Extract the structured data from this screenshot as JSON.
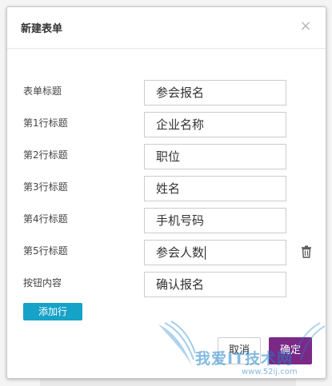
{
  "dialog": {
    "title": "新建表单",
    "close_glyph": "×",
    "close_icon": "close-icon"
  },
  "form": {
    "rows": [
      {
        "label": "表单标题",
        "value": "参会报名"
      },
      {
        "label": "第1行标题",
        "value": "企业名称"
      },
      {
        "label": "第2行标题",
        "value": "职位"
      },
      {
        "label": "第3行标题",
        "value": "姓名"
      },
      {
        "label": "第4行标题",
        "value": "手机号码"
      },
      {
        "label": "第5行标题",
        "value": "参会人数"
      },
      {
        "label": "按钮内容",
        "value": "确认报名"
      }
    ],
    "delete_icon": "trash-icon"
  },
  "actions": {
    "add_row": "添加行",
    "cancel": "取消",
    "confirm": "确定"
  },
  "watermark": {
    "text": "我爱IT技术网",
    "url": "www.52ij.com"
  },
  "colors": {
    "add_row_bg": "#17a2c8",
    "confirm_bg": "#7a2a86",
    "watermark": "#1e82c8"
  }
}
